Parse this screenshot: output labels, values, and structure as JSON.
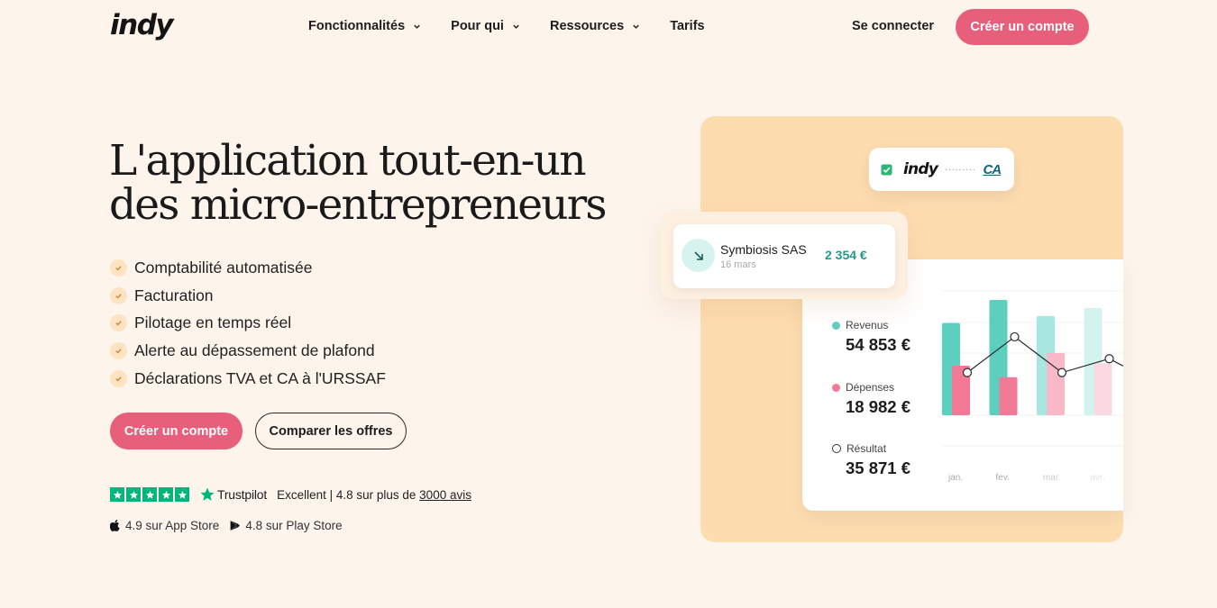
{
  "header": {
    "logo": "indy",
    "nav": [
      {
        "label": "Fonctionnalités",
        "dropdown": true
      },
      {
        "label": "Pour qui",
        "dropdown": true
      },
      {
        "label": "Ressources",
        "dropdown": true
      },
      {
        "label": "Tarifs",
        "dropdown": false
      }
    ],
    "login": "Se connecter",
    "signup": "Créer un compte"
  },
  "hero": {
    "title_line1": "L'application tout-en-un",
    "title_line2": "des micro-entrepreneurs",
    "features": [
      "Comptabilité automatisée",
      "Facturation",
      "Pilotage en temps réel",
      "Alerte au dépassement de plafond",
      "Déclarations TVA et CA à l'URSSAF"
    ],
    "cta_primary": "Créer un compte",
    "cta_secondary": "Comparer les offres"
  },
  "trustpilot": {
    "brand": "Trustpilot",
    "rating_text": "Excellent | 4.8 sur plus de",
    "reviews_link": "3000 avis"
  },
  "stores": {
    "app_store": "4.9 sur App Store",
    "play_store": "4.8 sur Play Store"
  },
  "illustration": {
    "bank_card": {
      "logo": "indy",
      "dots": "·········",
      "bank": "CA"
    },
    "transaction": {
      "name": "Symbiosis SAS",
      "date": "16 mars",
      "amount": "2 354 €"
    },
    "stats": {
      "revenus_label": "Revenus",
      "revenus_value": "54 853 €",
      "depenses_label": "Dépenses",
      "depenses_value": "18 982 €",
      "resultat_label": "Résultat",
      "resultat_value": "35 871 €"
    },
    "chart": {
      "months": [
        "jan.",
        "fev.",
        "mar.",
        "avr."
      ],
      "revenus": [
        0.8,
        1.0,
        0.86,
        0.93
      ],
      "depenses": [
        0.43,
        0.33,
        0.54,
        0.45
      ],
      "resultat_line": [
        0.37,
        0.68,
        0.37,
        0.49
      ],
      "colors": {
        "revenus": [
          "#5dcfbe",
          "#5dcfbe",
          "#a8e7df",
          "#d3f3ef"
        ],
        "depenses": [
          "#f27a97",
          "#f27a97",
          "#f8b8c8",
          "#fbd9e2"
        ],
        "months": [
          "#aaaaaa",
          "#aaaaaa",
          "#cccccc",
          "#e2e2e2"
        ]
      }
    }
  },
  "colors": {
    "accent": "#e85f7c",
    "background": "#fdf4ec",
    "panel": "#fddcb0",
    "teal": "#5dcfbe",
    "pink": "#f27a97"
  }
}
